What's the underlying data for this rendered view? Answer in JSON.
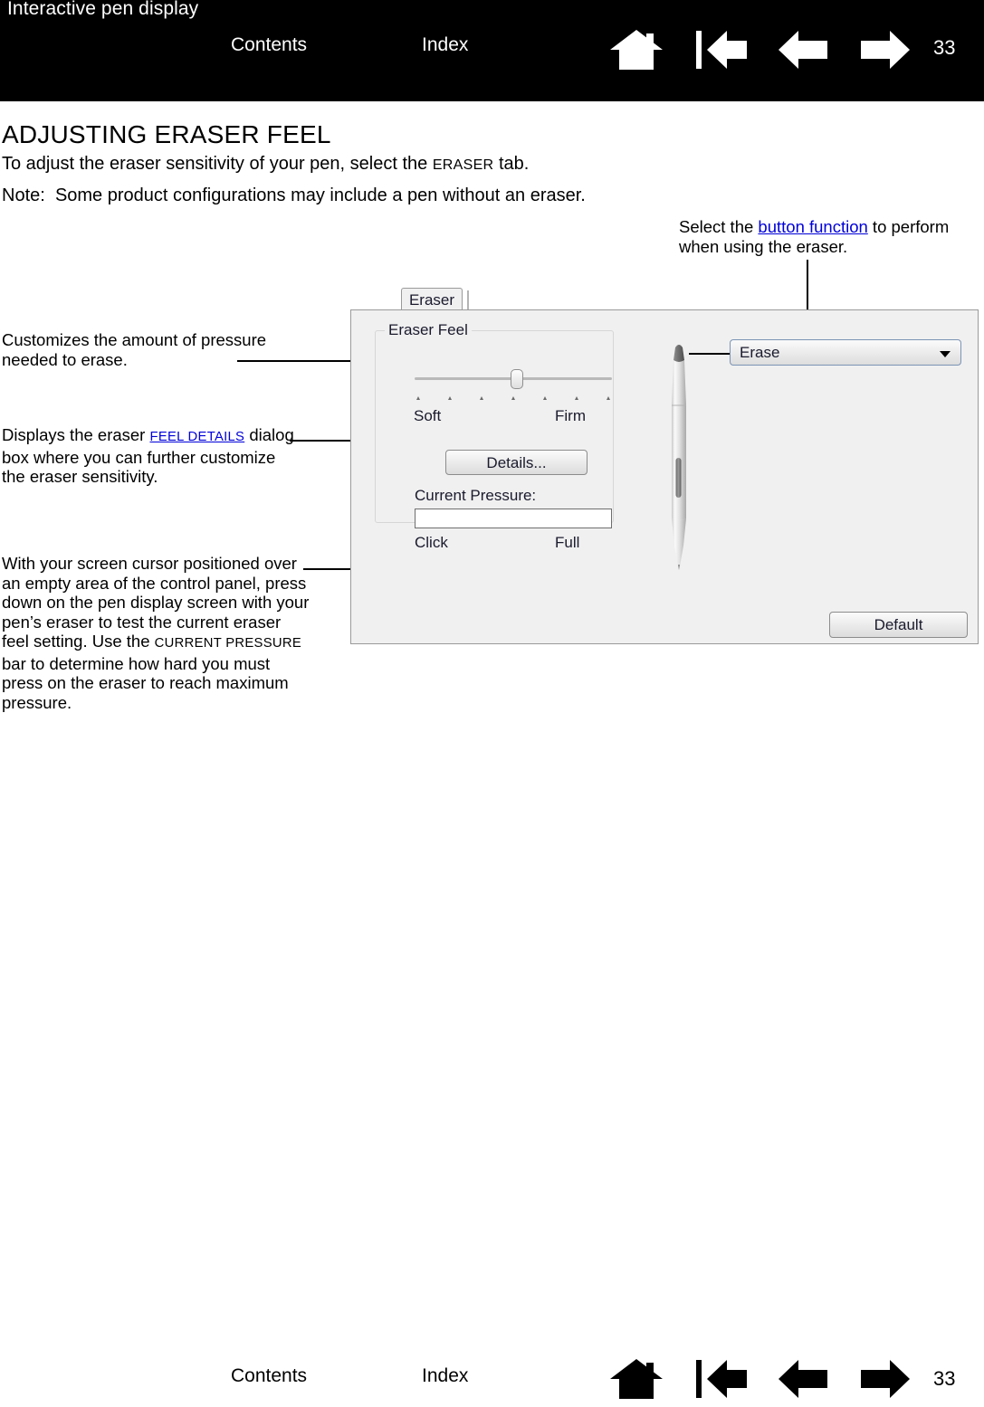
{
  "header": {
    "title": "Interactive pen display",
    "contents_label": "Contents",
    "index_label": "Index",
    "page_number": "33",
    "icons": [
      "home-icon",
      "go-to-first-icon",
      "previous-page-icon",
      "next-page-icon"
    ],
    "background_color": "#000000",
    "text_color": "#ffffff"
  },
  "content": {
    "heading": "ADJUSTING ERASER FEEL",
    "intro_before": "To adjust the eraser sensitivity of your pen, select the ",
    "intro_smallcaps": "ERASER",
    "intro_after": " tab.",
    "note_label": "Note:",
    "note_text": "Some product configurations may include a pen without an eraser."
  },
  "annotations": {
    "top_right": {
      "before": "Select the ",
      "link": "button function",
      "after": " to perform when using the eraser."
    },
    "eraser_feel": "Customizes the amount of pressure needed to erase.",
    "details": {
      "before": "Displays the eraser ",
      "link": "FEEL DETAILS",
      "after": " dialog box where you can further customize the eraser sensitivity."
    },
    "current_pressure": {
      "part1": "With your screen cursor positioned over an empty area of the control panel, press down on the pen display screen with your pen’s eraser to test the current eraser feel setting.  Use the ",
      "smallcaps": "CURRENT PRESSURE",
      "part2": " bar to determine how hard you must press on the eraser to reach maximum pressure."
    }
  },
  "control_panel": {
    "tab_label": "Eraser",
    "group_title": "Eraser Feel",
    "slider": {
      "min_label": "Soft",
      "max_label": "Firm",
      "tick_count": 7,
      "value_index": 3
    },
    "details_button": "Details...",
    "current_pressure_label": "Current Pressure:",
    "pressure_min_label": "Click",
    "pressure_max_label": "Full",
    "pressure_value": "",
    "dropdown": {
      "selected": "Erase",
      "icon": "chevron-down-icon"
    },
    "default_button": "Default",
    "pen_illustration": "pen-with-eraser-icon",
    "background_color": "#f0f0f0",
    "label_color": "#1a1a2e"
  },
  "footer": {
    "contents_label": "Contents",
    "index_label": "Index",
    "page_number": "33",
    "icons": [
      "home-icon",
      "go-to-first-icon",
      "previous-page-icon",
      "next-page-icon"
    ]
  },
  "link_color": "#0000d8"
}
